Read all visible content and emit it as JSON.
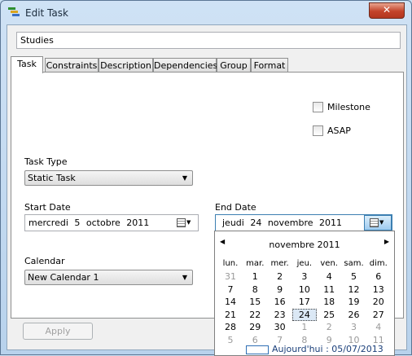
{
  "window": {
    "title": "Edit Task",
    "close_label": "✕"
  },
  "task_name": "Studies",
  "tabs": [
    "Task",
    "Constraints",
    "Description",
    "Dependencies",
    "Group",
    "Format"
  ],
  "options": {
    "milestone": "Milestone",
    "asap": "ASAP"
  },
  "task_type": {
    "label": "Task Type",
    "value": "Static Task"
  },
  "start_date": {
    "label": "Start Date",
    "value": "mercredi 5 octobre 2011"
  },
  "end_date": {
    "label": "End Date",
    "value": "jeudi 24 novembre 2011"
  },
  "calendar": {
    "label": "Calendar",
    "value": "New Calendar 1"
  },
  "apply_label": "Apply",
  "datepicker": {
    "month": "novembre 2011",
    "weekdays": [
      "lun.",
      "mar.",
      "mer.",
      "jeu.",
      "ven.",
      "sam.",
      "dim."
    ],
    "weeks": [
      [
        "31",
        "1",
        "2",
        "3",
        "4",
        "5",
        "6"
      ],
      [
        "7",
        "8",
        "9",
        "10",
        "11",
        "12",
        "13"
      ],
      [
        "14",
        "15",
        "16",
        "17",
        "18",
        "19",
        "20"
      ],
      [
        "21",
        "22",
        "23",
        "24",
        "25",
        "26",
        "27"
      ],
      [
        "28",
        "29",
        "30",
        "1",
        "2",
        "3",
        "4"
      ],
      [
        "5",
        "6",
        "7",
        "8",
        "9",
        "10",
        "11"
      ]
    ],
    "other_month_flags": [
      [
        true,
        false,
        false,
        false,
        false,
        false,
        false
      ],
      [
        false,
        false,
        false,
        false,
        false,
        false,
        false
      ],
      [
        false,
        false,
        false,
        false,
        false,
        false,
        false
      ],
      [
        false,
        false,
        false,
        false,
        false,
        false,
        false
      ],
      [
        false,
        false,
        false,
        true,
        true,
        true,
        true
      ],
      [
        true,
        true,
        true,
        true,
        true,
        true,
        true
      ]
    ],
    "selected_day": "24",
    "today_text": "Aujourd'hui : 05/07/2013"
  },
  "colors": {
    "title_bar": "#b8d2ec",
    "close_button": "#c3432a",
    "link_blue": "#1a3f7a"
  }
}
